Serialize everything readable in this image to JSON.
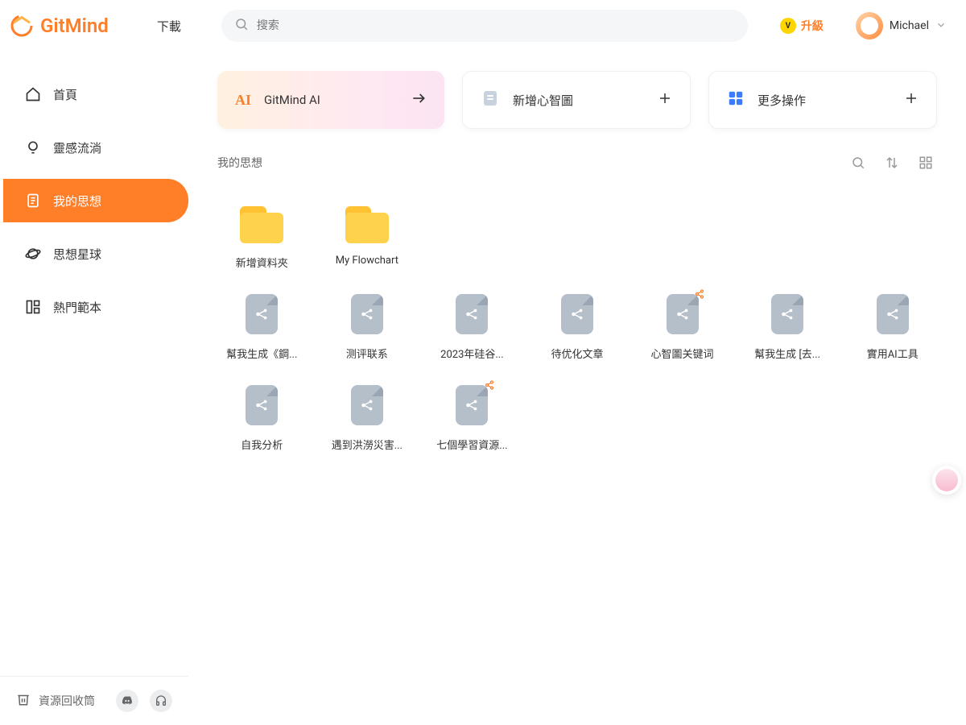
{
  "brand": "GitMind",
  "topbar": {
    "download": "下載",
    "search_placeholder": "搜索",
    "upgrade": "升級",
    "username": "Michael"
  },
  "sidebar": {
    "items": [
      {
        "label": "首頁"
      },
      {
        "label": "靈感流淌"
      },
      {
        "label": "我的思想"
      },
      {
        "label": "思想星球"
      },
      {
        "label": "熱門範本"
      }
    ],
    "trash": "資源回收筒"
  },
  "actions": {
    "ai": "GitMind AI",
    "new_mindmap": "新增心智圖",
    "more": "更多操作"
  },
  "section_title": "我的思想",
  "items": [
    {
      "type": "folder",
      "label": "新增資料夾",
      "shared": false
    },
    {
      "type": "folder",
      "label": "My Flowchart",
      "shared": false
    },
    {
      "type": "doc",
      "label": "幫我生成《鋼...",
      "shared": false
    },
    {
      "type": "doc",
      "label": "测评联系",
      "shared": false
    },
    {
      "type": "doc",
      "label": "2023年硅谷...",
      "shared": false
    },
    {
      "type": "doc",
      "label": "待优化文章",
      "shared": false
    },
    {
      "type": "doc",
      "label": "心智圖关键词",
      "shared": true
    },
    {
      "type": "doc",
      "label": "幫我生成 [去...",
      "shared": false
    },
    {
      "type": "doc",
      "label": "實用AI工具",
      "shared": false
    },
    {
      "type": "doc",
      "label": "自我分析",
      "shared": false
    },
    {
      "type": "doc",
      "label": "遇到洪澇災害...",
      "shared": false
    },
    {
      "type": "doc",
      "label": "七個學習資源...",
      "shared": true
    }
  ]
}
